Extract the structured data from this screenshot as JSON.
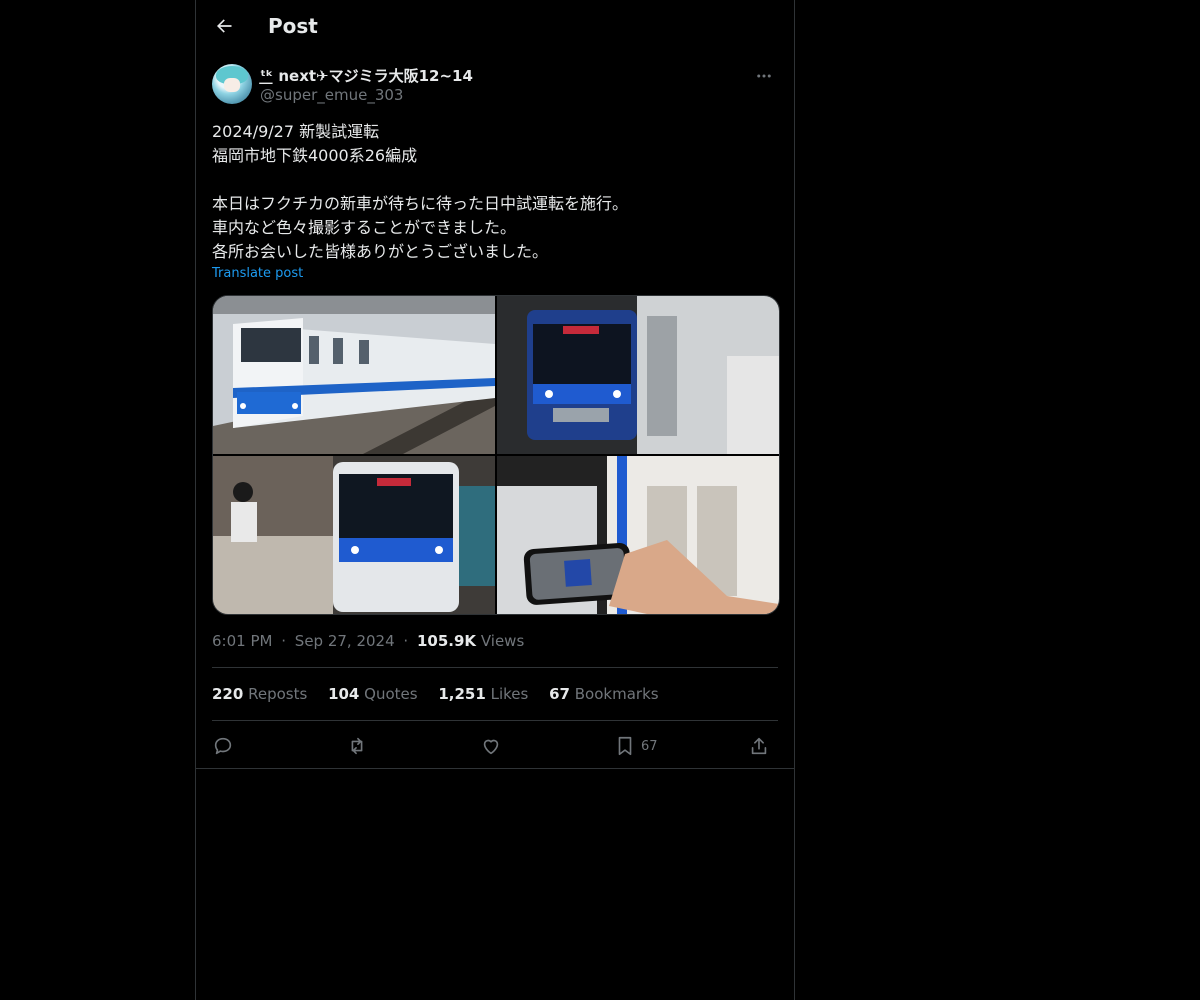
{
  "header": {
    "title": "Post"
  },
  "author": {
    "display_name": "ᵗ͟ᵏ next✈マジミラ大阪12~14",
    "handle": "@super_emue_303"
  },
  "post": {
    "text": "2024/9/27 新製試運転\n福岡市地下鉄4000系26編成\n\n本日はフクチカの新車が待ちに待った日中試運転を施行。\n車内など色々撮影することができました。\n各所お会いした皆様ありがとうございました。",
    "translate_label": "Translate post",
    "time": "6:01 PM",
    "date": "Sep 27, 2024",
    "separator": "·",
    "views_count": "105.9K",
    "views_label": "Views"
  },
  "stats": {
    "reposts_count": "220",
    "reposts_label": "Reposts",
    "quotes_count": "104",
    "quotes_label": "Quotes",
    "likes_count": "1,251",
    "likes_label": "Likes",
    "bookmarks_count": "67",
    "bookmarks_label": "Bookmarks"
  },
  "actions": {
    "bookmark_count": "67",
    "icons": [
      "reply-icon",
      "repost-icon",
      "like-icon",
      "bookmark-icon",
      "share-icon"
    ]
  },
  "colors": {
    "accent": "#1d9bf0",
    "background": "#000000",
    "muted": "#71767b",
    "border": "#2f3336"
  }
}
